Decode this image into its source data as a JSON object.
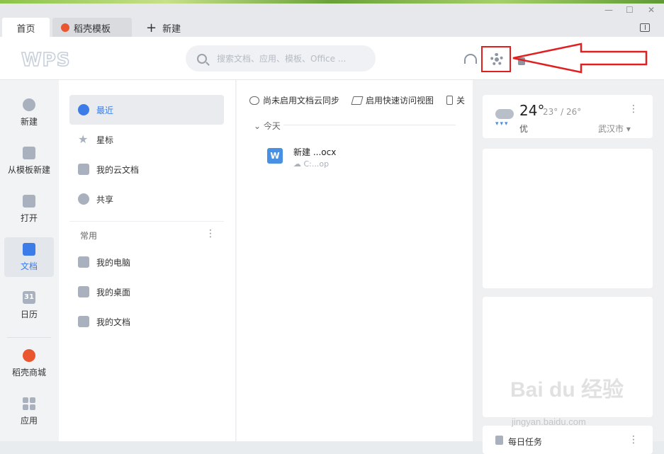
{
  "tabs": {
    "home": "首页",
    "template": "稻壳模板",
    "new": "新建"
  },
  "window_controls": {
    "minimize": "—",
    "maximize": "☐",
    "close": "✕"
  },
  "header": {
    "logo": "WPS",
    "search_placeholder": "搜索文档、应用、模板、Office ..."
  },
  "leftnav": {
    "items": [
      {
        "label": "新建"
      },
      {
        "label": "从模板新建"
      },
      {
        "label": "打开"
      },
      {
        "label": "文档"
      },
      {
        "label": "日历",
        "icon_text": "31"
      },
      {
        "label": "稻壳商城"
      },
      {
        "label": "应用"
      }
    ]
  },
  "col2": {
    "items": [
      {
        "label": "最近"
      },
      {
        "label": "星标"
      },
      {
        "label": "我的云文档"
      },
      {
        "label": "共享"
      }
    ],
    "section": "常用",
    "common": [
      {
        "label": "我的电脑"
      },
      {
        "label": "我的桌面"
      },
      {
        "label": "我的文档"
      }
    ]
  },
  "main": {
    "toolbar": [
      "尚未启用文档云同步",
      "启用快速访问视图",
      "关"
    ],
    "group": "今天",
    "files": [
      {
        "icon": "W",
        "name": "新建 ...ocx",
        "path": "C:...op"
      }
    ]
  },
  "weather": {
    "temp": "24°",
    "range": "23° / 26°",
    "quality": "优",
    "city": "武汉市 ▾"
  },
  "task": {
    "label": "每日任务"
  },
  "watermark": {
    "main": "Bai du 经验",
    "sub": "jingyan.baidu.com"
  },
  "colors": {
    "accent": "#3b7ce8",
    "highlight": "#e02020",
    "brand": "#e9562f"
  }
}
